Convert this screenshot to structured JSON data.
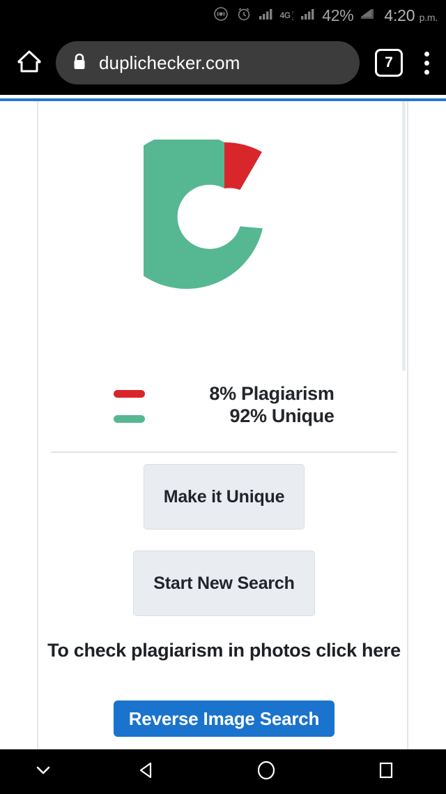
{
  "statusbar": {
    "icons": [
      "cast-icon",
      "alarm-icon",
      "signal-bars-icon",
      "arrows-updown-icon",
      "signal-bars-2-icon",
      "battery-icon"
    ],
    "network_type": "4G",
    "battery_percent": "42%",
    "time": "4:20",
    "ampm": "p.m."
  },
  "browser": {
    "home_icon": "home-icon",
    "lock_icon": "lock-icon",
    "url": "duplichecker.com",
    "tab_count": "7",
    "menu_icon": "overflow-menu-icon"
  },
  "page": {
    "legend": [
      {
        "label": "8% Plagiarism",
        "color": "#d8262a"
      },
      {
        "label": "92% Unique",
        "color": "#56b893"
      }
    ],
    "buttons": {
      "make_unique": "Make it Unique",
      "start_new_search": "Start New Search",
      "reverse_image_search": "Reverse Image Search"
    },
    "promo_text": "To check plagiarism in photos click here",
    "colors": {
      "plagiarism": "#d8262a",
      "unique": "#56b893",
      "cta": "#1a73cd",
      "ghost_button": "#e9edf1",
      "progress": "#2579d1"
    }
  },
  "chart_data": {
    "type": "pie",
    "variant": "donut",
    "title": "",
    "categories": [
      "Plagiarism",
      "Unique"
    ],
    "values": [
      8,
      92
    ],
    "unit": "%",
    "colors": [
      "#d8262a",
      "#56b893"
    ],
    "legend_position": "below",
    "start_angle_deg": 0,
    "direction": "clockwise",
    "inner_radius_ratio": 0.59,
    "labels": [
      "8% Plagiarism",
      "92% Unique"
    ]
  },
  "navbar": {
    "items": [
      "chevron-down-icon",
      "back-triangle-icon",
      "home-circle-icon",
      "recents-square-icon"
    ]
  }
}
